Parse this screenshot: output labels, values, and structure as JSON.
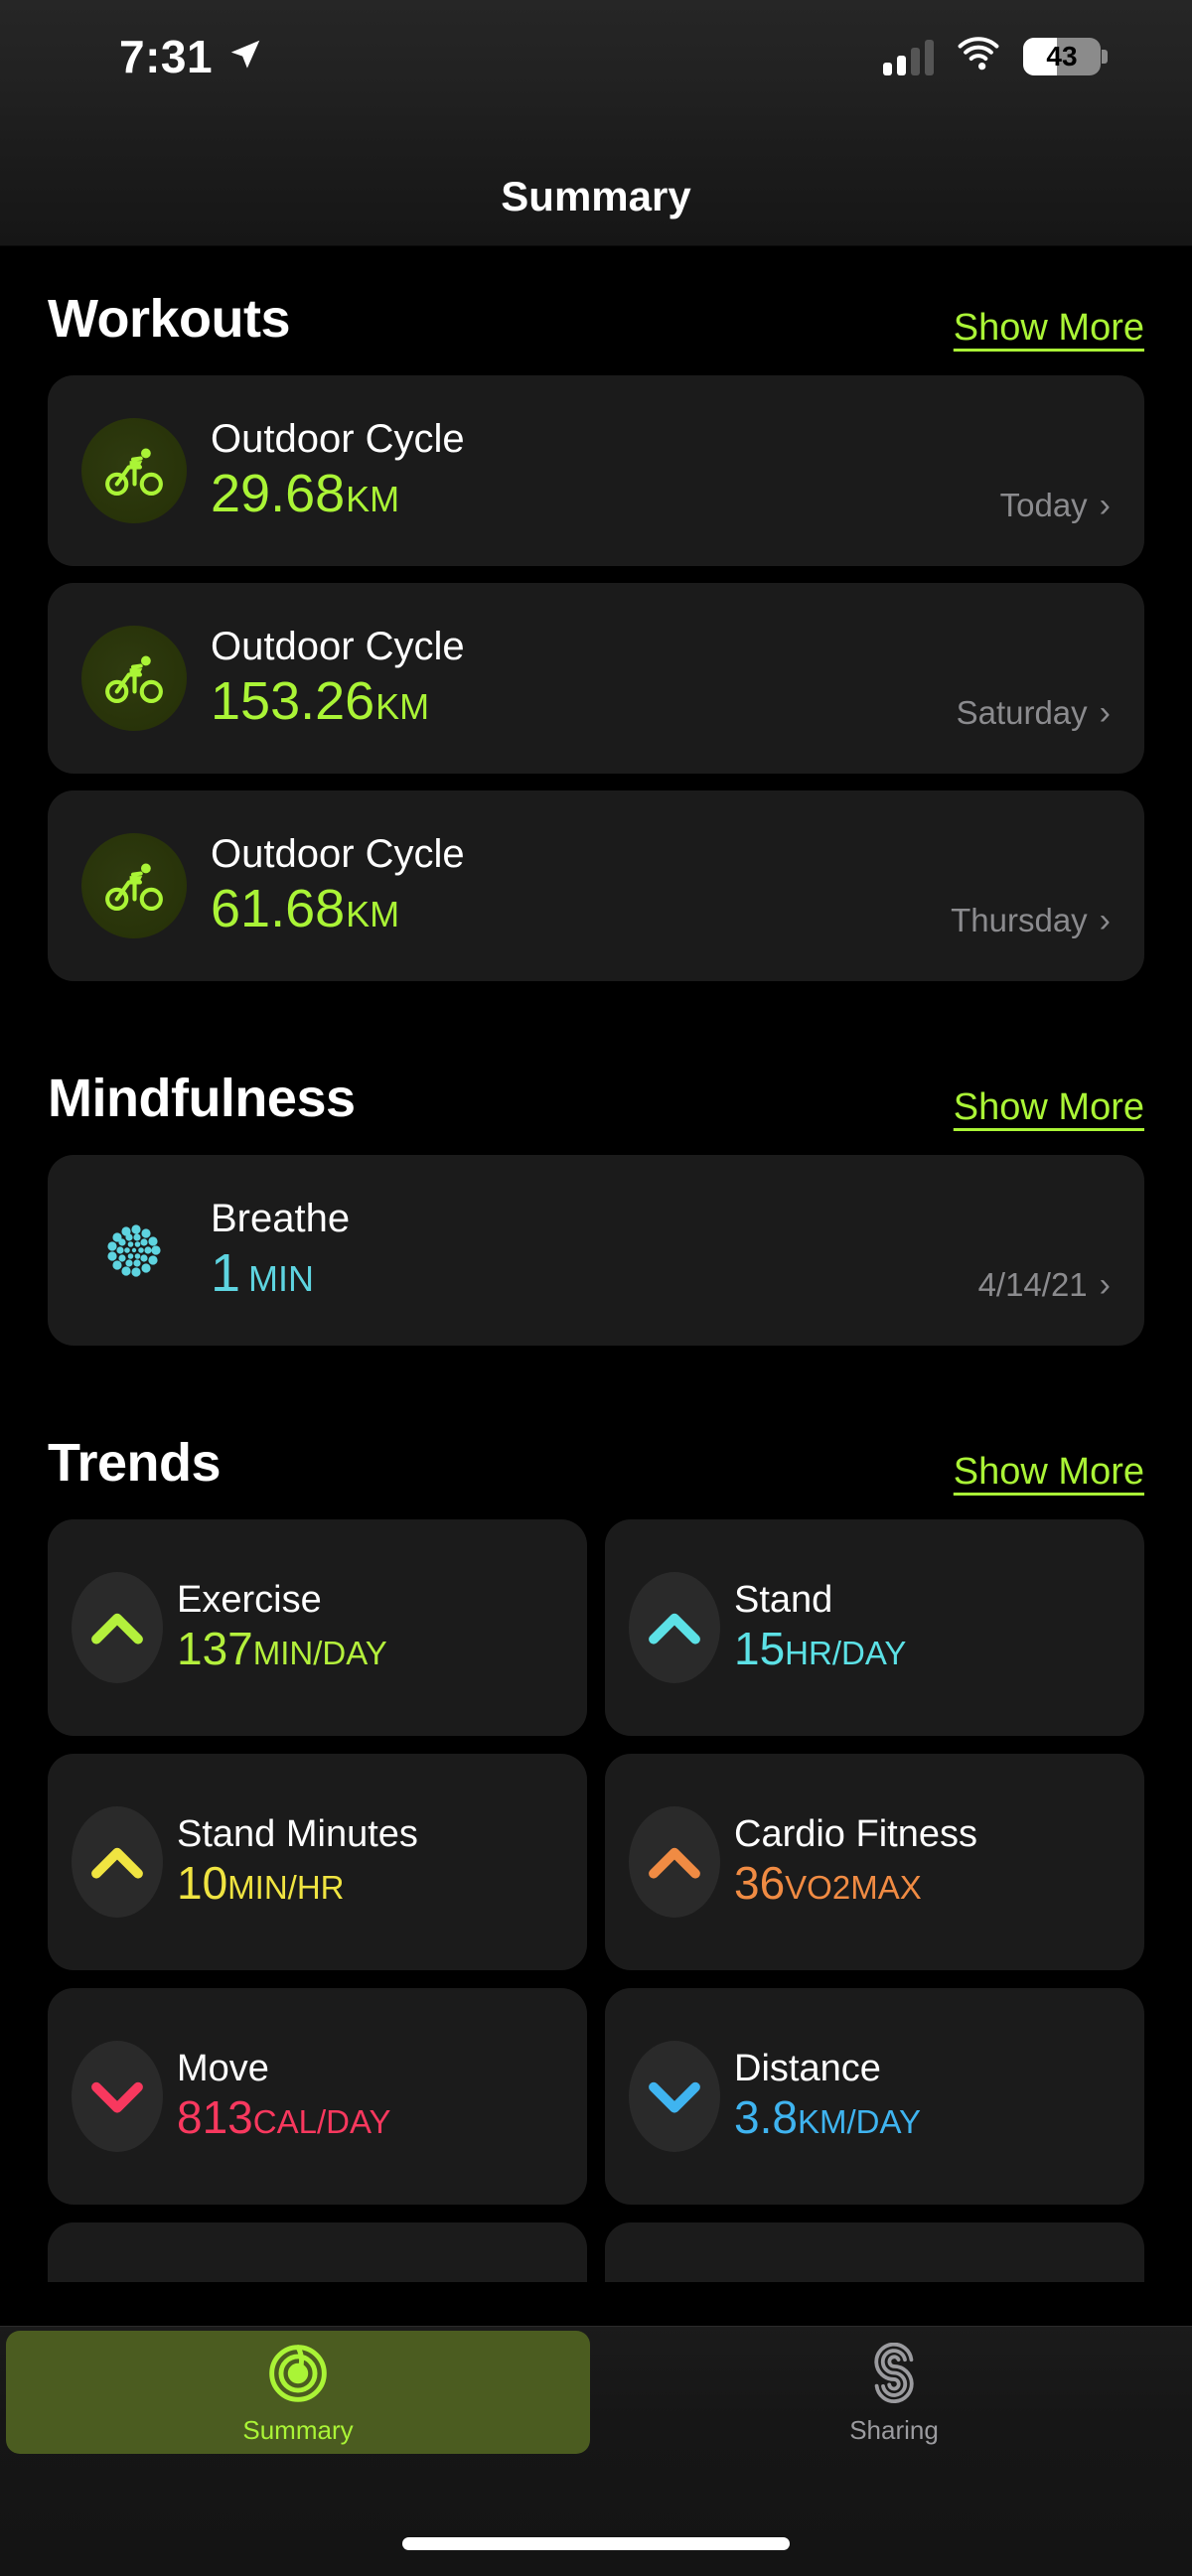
{
  "status_bar": {
    "time": "7:31",
    "location_icon": "location-arrow-icon",
    "signal_icon": "cellular-signal-icon",
    "signal_bars_filled": 2,
    "signal_bars_total": 4,
    "wifi_icon": "wifi-icon",
    "battery_level": "43",
    "battery_percent": 43
  },
  "nav": {
    "title": "Summary"
  },
  "sections": {
    "workouts": {
      "title": "Workouts",
      "show_more": "Show More",
      "items": [
        {
          "name": "Outdoor Cycle",
          "value": "29.68",
          "unit": "KM",
          "date": "Today",
          "icon": "cycling-icon",
          "color": "#aaf436"
        },
        {
          "name": "Outdoor Cycle",
          "value": "153.26",
          "unit": "KM",
          "date": "Saturday",
          "icon": "cycling-icon",
          "color": "#aaf436"
        },
        {
          "name": "Outdoor Cycle",
          "value": "61.68",
          "unit": "KM",
          "date": "Thursday",
          "icon": "cycling-icon",
          "color": "#aaf436"
        }
      ]
    },
    "mindfulness": {
      "title": "Mindfulness",
      "show_more": "Show More",
      "items": [
        {
          "name": "Breathe",
          "value": "1",
          "unit": "MIN",
          "date": "4/14/21",
          "icon": "breathe-icon",
          "color": "#5ed4e0"
        }
      ]
    },
    "trends": {
      "title": "Trends",
      "show_more": "Show More",
      "tiles": [
        {
          "name": "Exercise",
          "value": "137",
          "unit": "MIN/DAY",
          "direction": "up",
          "icon": "chevron-up-icon",
          "color": "#b4f03c"
        },
        {
          "name": "Stand",
          "value": "15",
          "unit": "HR/DAY",
          "direction": "up",
          "icon": "chevron-up-icon",
          "color": "#5ce1e6"
        },
        {
          "name": "Stand Minutes",
          "value": "10",
          "unit": "MIN/HR",
          "direction": "up",
          "icon": "chevron-up-icon",
          "color": "#f0e441"
        },
        {
          "name": "Cardio Fitness",
          "value": "36",
          "unit": "VO2MAX",
          "direction": "up",
          "icon": "chevron-up-icon",
          "color": "#f08b43"
        },
        {
          "name": "Move",
          "value": "813",
          "unit": "CAL/DAY",
          "direction": "down",
          "icon": "chevron-down-icon",
          "color": "#f8385e"
        },
        {
          "name": "Distance",
          "value": "3.8",
          "unit": "KM/DAY",
          "direction": "down",
          "icon": "chevron-down-icon",
          "color": "#3fb4f0"
        }
      ]
    }
  },
  "tabbar": {
    "tabs": [
      {
        "label": "Summary",
        "icon": "summary-target-icon",
        "active": true
      },
      {
        "label": "Sharing",
        "icon": "sharing-s-icon",
        "active": false
      }
    ]
  },
  "colors": {
    "accent_green": "#aaf436",
    "background": "#000000",
    "card": "#1b1b1b",
    "muted_text": "#8b8b8e"
  }
}
